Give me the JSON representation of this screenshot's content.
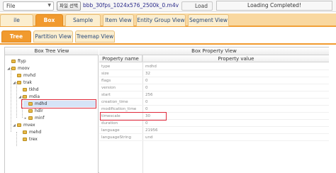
{
  "topbar": {
    "file_label": "File",
    "choose_button": "파일 선택",
    "file_name": "bbb_30fps_1024x576_2500k_0.m4v",
    "load_label": "Load",
    "progress_text": "Loading Completed!",
    "progress_fraction": 1.0
  },
  "main_tabs": [
    {
      "label": "ile Overview"
    },
    {
      "label": "Box View"
    },
    {
      "label": "Sample View"
    },
    {
      "label": "Item View"
    },
    {
      "label": "Entity Group View"
    },
    {
      "label": "Segment View"
    }
  ],
  "sub_tabs": [
    {
      "label": "Tree View"
    },
    {
      "label": "Partition View"
    },
    {
      "label": "Treemap View"
    }
  ],
  "left_panel": {
    "title": "Box Tree View",
    "nodes": [
      {
        "label": "ftyp"
      },
      {
        "label": "moov"
      },
      {
        "label": "mvhd"
      },
      {
        "label": "trak"
      },
      {
        "label": "tkhd"
      },
      {
        "label": "mdia"
      },
      {
        "label": "mdhd"
      },
      {
        "label": "hdlr"
      },
      {
        "label": "minf"
      },
      {
        "label": "mvex"
      },
      {
        "label": "mehd"
      },
      {
        "label": "trex"
      }
    ]
  },
  "right_panel": {
    "title": "Box Property View",
    "col_name": "Property name",
    "col_value": "Property value",
    "rows": [
      {
        "name": "type",
        "value": "mdhd"
      },
      {
        "name": "size",
        "value": "32"
      },
      {
        "name": "flags",
        "value": "0"
      },
      {
        "name": "version",
        "value": "0"
      },
      {
        "name": "start",
        "value": "256"
      },
      {
        "name": "creation_time",
        "value": "0"
      },
      {
        "name": "modification_time",
        "value": "0"
      },
      {
        "name": "timescale",
        "value": "30"
      },
      {
        "name": "duration",
        "value": "0"
      },
      {
        "name": "language",
        "value": "21956"
      },
      {
        "name": "languageString",
        "value": "und"
      }
    ]
  },
  "colors": {
    "tab_active": "#f19a2e",
    "tab_inactive": "#fbeecf",
    "tab_strip": "#f9d8a0",
    "highlight_box": "#e0283a",
    "selected_node": "#d6e4f7"
  }
}
